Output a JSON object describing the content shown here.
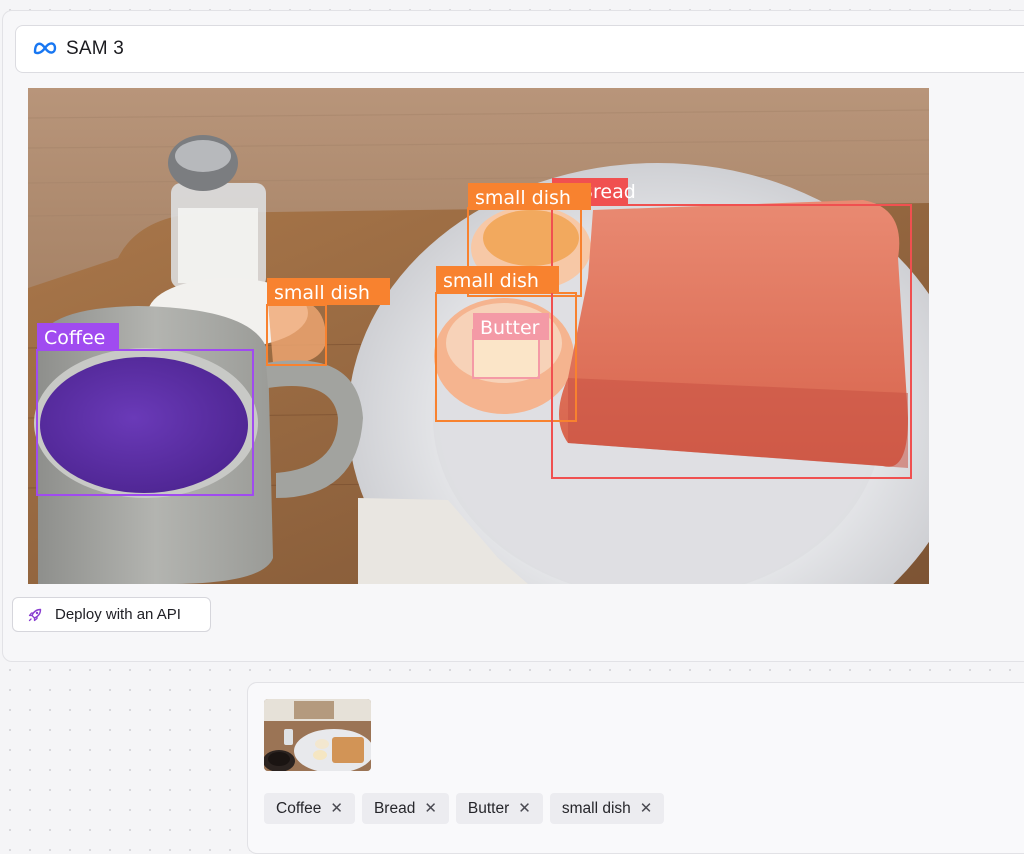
{
  "app": {
    "model_name": "SAM 3",
    "logo_icon": "meta-logo-icon"
  },
  "detections": [
    {
      "label": "Coffee",
      "color": "#a04bf0"
    },
    {
      "label": "small dish",
      "color": "#f8822f"
    },
    {
      "label": "small dish",
      "color": "#f8822f"
    },
    {
      "label": "small dish",
      "color": "#f8822f"
    },
    {
      "label": "Butter",
      "color": "#f49aa6"
    },
    {
      "label": "Bread",
      "color": "#f05050"
    }
  ],
  "actions": {
    "deploy_label": "Deploy with an API",
    "deploy_icon": "rocket-icon"
  },
  "prompts": [
    {
      "label": "Coffee",
      "remove_symbol": "✕"
    },
    {
      "label": "Bread",
      "remove_symbol": "✕"
    },
    {
      "label": "Butter",
      "remove_symbol": "✕"
    },
    {
      "label": "small dish",
      "remove_symbol": "✕"
    }
  ]
}
